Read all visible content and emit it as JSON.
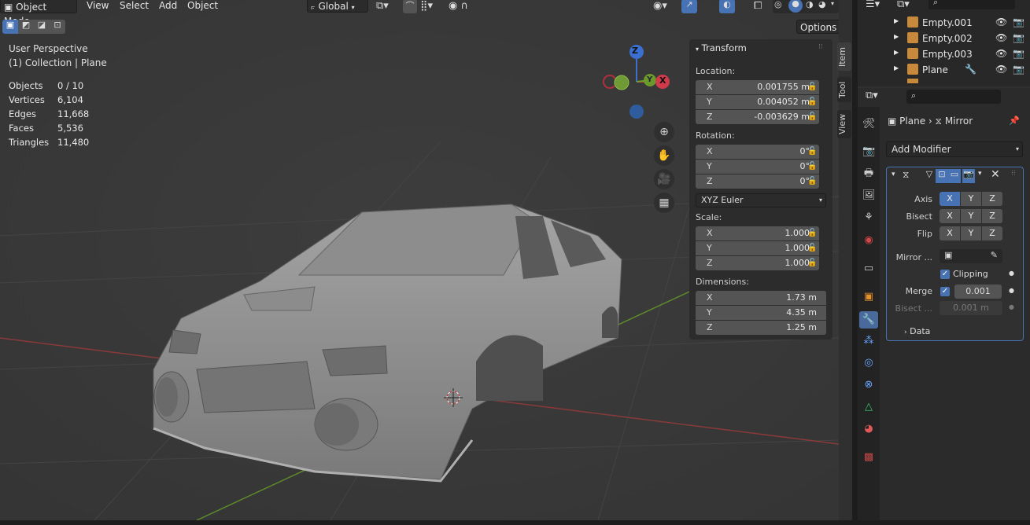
{
  "header": {
    "mode": "Object Mode",
    "menus": [
      "View",
      "Select",
      "Add",
      "Object"
    ],
    "transform_orientation": "Global",
    "options_label": "Options"
  },
  "viewport": {
    "view_name": "User Perspective",
    "collection": "(1) Collection | Plane",
    "stats": [
      {
        "label": "Objects",
        "value": "0 / 10"
      },
      {
        "label": "Vertices",
        "value": "6,104"
      },
      {
        "label": "Edges",
        "value": "11,668"
      },
      {
        "label": "Faces",
        "value": "5,536"
      },
      {
        "label": "Triangles",
        "value": "11,480"
      }
    ],
    "gizmo_axes": {
      "z": "Z",
      "x": "X",
      "y": "Y"
    }
  },
  "npanel": {
    "title": "Transform",
    "location_label": "Location:",
    "location": [
      {
        "axis": "X",
        "value": "0.001755 m"
      },
      {
        "axis": "Y",
        "value": "0.004052 m"
      },
      {
        "axis": "Z",
        "value": "-0.003629 m"
      }
    ],
    "rotation_label": "Rotation:",
    "rotation": [
      {
        "axis": "X",
        "value": "0°"
      },
      {
        "axis": "Y",
        "value": "0°"
      },
      {
        "axis": "Z",
        "value": "0°"
      }
    ],
    "rotation_mode": "XYZ Euler",
    "scale_label": "Scale:",
    "scale": [
      {
        "axis": "X",
        "value": "1.000"
      },
      {
        "axis": "Y",
        "value": "1.000"
      },
      {
        "axis": "Z",
        "value": "1.000"
      }
    ],
    "dimensions_label": "Dimensions:",
    "dimensions": [
      {
        "axis": "X",
        "value": "1.73 m"
      },
      {
        "axis": "Y",
        "value": "4.35 m"
      },
      {
        "axis": "Z",
        "value": "1.25 m"
      }
    ],
    "tabs": [
      "Item",
      "Tool",
      "View"
    ]
  },
  "outliner": {
    "rows": [
      {
        "name": "Empty.001"
      },
      {
        "name": "Empty.002"
      },
      {
        "name": "Empty.003"
      },
      {
        "name": "Plane"
      }
    ]
  },
  "properties": {
    "breadcrumb_object": "Plane",
    "breadcrumb_modifier": "Mirror",
    "add_modifier": "Add Modifier",
    "axis_label": "Axis",
    "bisect_label": "Bisect",
    "flip_label": "Flip",
    "xyz": [
      "X",
      "Y",
      "Z"
    ],
    "mirror_object_label": "Mirror ...",
    "clipping_label": "Clipping",
    "merge_label": "Merge",
    "merge_value": "0.001",
    "bisect_dist_label": "Bisect ...",
    "bisect_dist_value": "0.001 m",
    "data_label": "Data",
    "colors": {
      "accent": "#4772b3",
      "active_tab": "#4a6a9c"
    }
  }
}
